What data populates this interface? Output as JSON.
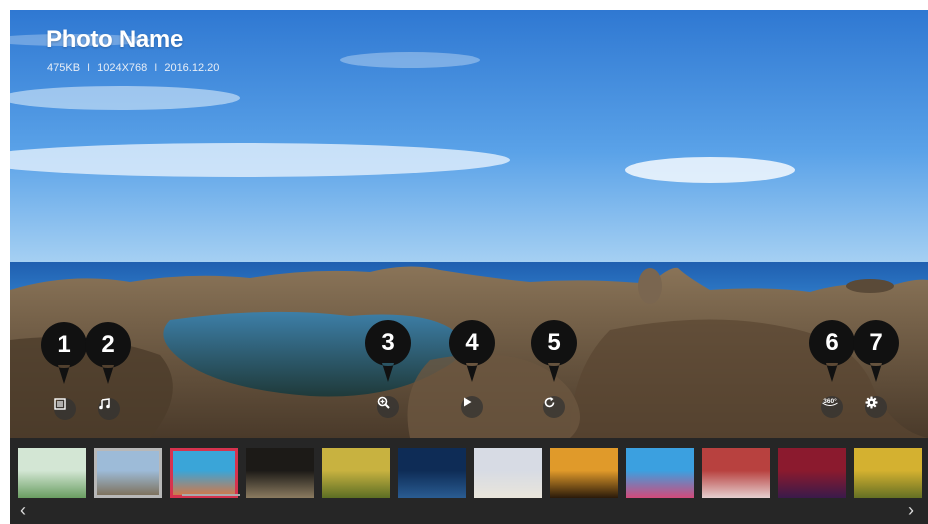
{
  "photo": {
    "title": "Photo Name",
    "size": "475KB",
    "resolution": "1024X768",
    "date": "2016.12.20",
    "separator": "I"
  },
  "controls": [
    {
      "id": "list",
      "icon": "list-icon"
    },
    {
      "id": "music",
      "icon": "music-note-icon"
    },
    {
      "id": "zoom",
      "icon": "zoom-in-icon"
    },
    {
      "id": "slideshow",
      "icon": "play-icon"
    },
    {
      "id": "rotate",
      "icon": "rotate-icon"
    },
    {
      "id": "360",
      "icon": "360-view-icon",
      "label": "360°"
    },
    {
      "id": "settings",
      "icon": "gear-icon"
    }
  ],
  "callouts": [
    "1",
    "2",
    "3",
    "4",
    "5",
    "6",
    "7"
  ],
  "thumbnails": [
    {
      "id": "t1",
      "colors": [
        "#d3e6d4",
        "#6a9e62"
      ]
    },
    {
      "id": "t2",
      "colors": [
        "#9dbbd8",
        "#7b6a50"
      ],
      "selected": true
    },
    {
      "id": "t3",
      "colors": [
        "#3aa5d8",
        "#e2743a"
      ],
      "current": true
    },
    {
      "id": "t4",
      "colors": [
        "#1c1a17",
        "#8b7b60"
      ]
    },
    {
      "id": "t5",
      "colors": [
        "#c8b240",
        "#5c6e24"
      ]
    },
    {
      "id": "t6",
      "colors": [
        "#0e2c56",
        "#2a5c92"
      ]
    },
    {
      "id": "t7",
      "colors": [
        "#d7dbe4",
        "#e9e5db"
      ]
    },
    {
      "id": "t8",
      "colors": [
        "#e09a2a",
        "#2a1a0a"
      ]
    },
    {
      "id": "t9",
      "colors": [
        "#3ba0e0",
        "#d24a7a"
      ]
    },
    {
      "id": "t10",
      "colors": [
        "#b8413f",
        "#e5cfcf"
      ]
    },
    {
      "id": "t11",
      "colors": [
        "#8b1a2e",
        "#3a1a4a"
      ]
    },
    {
      "id": "t12",
      "colors": [
        "#d4b130",
        "#657024"
      ]
    }
  ],
  "nav": {
    "prev": "‹",
    "next": "›"
  },
  "colors": {
    "current_border": "#d6334e",
    "selected_border": "#b8b8b8",
    "strip_bg": "#262626",
    "callout": "#111111"
  }
}
